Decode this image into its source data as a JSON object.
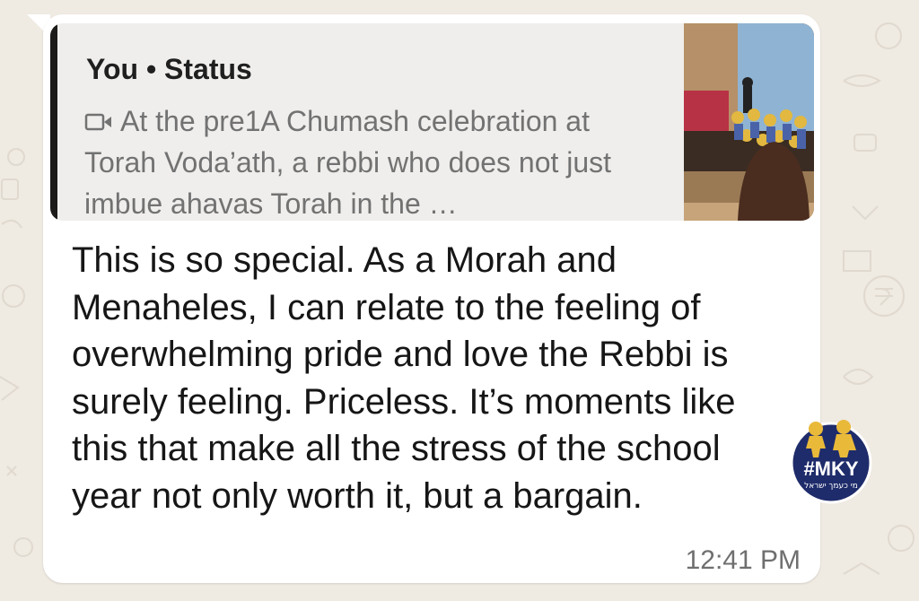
{
  "colors": {
    "background": "#efeae2",
    "bubble": "#ffffff",
    "quote_background": "#f0eeec",
    "quote_bar": "#1d1b19",
    "message_text": "#161616",
    "muted_text": "#727272"
  },
  "quoted_status": {
    "author": "You",
    "separator": " • ",
    "label": "Status",
    "media_icon": "video-camera-icon",
    "text": "At the pre1A Chumash celebration at Torah Voda’ath, a rebbi who does not just imbue ahavas Torah in the …"
  },
  "message": {
    "text": "This is so special. As a Morah and Menaheles, I can relate to the feeling of overwhelming pride and love the Rebbi is surely feeling. Priceless. It’s moments like this that make all the stress of the school year not only worth it, but a bargain.",
    "time": "12:41 PM"
  },
  "watermark": {
    "tag": "#MKY",
    "subtitle": "מי כעמך ישראל"
  }
}
